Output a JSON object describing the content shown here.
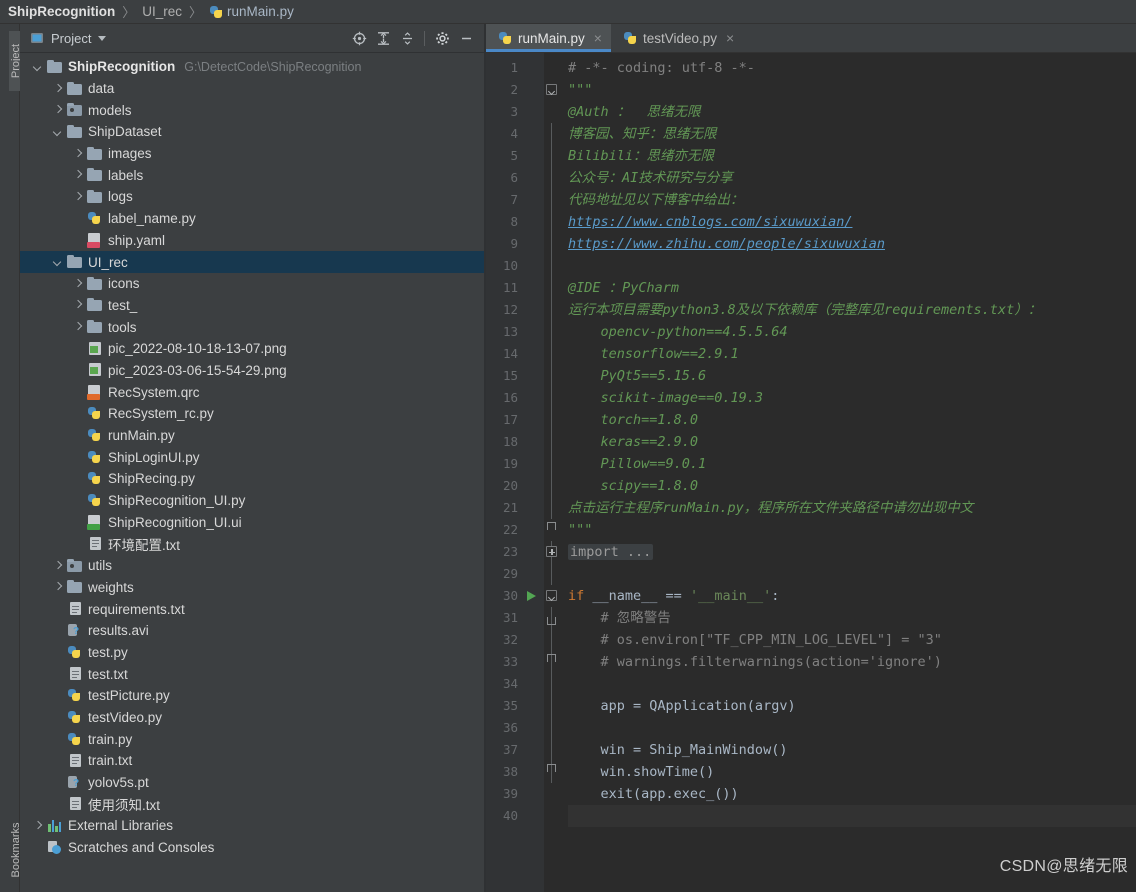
{
  "breadcrumb": {
    "items": [
      {
        "label": "ShipRecognition",
        "icon": "none",
        "style": "root"
      },
      {
        "label": "UI_rec",
        "icon": "none",
        "style": "mid"
      },
      {
        "label": "runMain.py",
        "icon": "python-icon",
        "style": "leaf"
      }
    ],
    "separator": "〉"
  },
  "left_strip": {
    "project_label": "Project",
    "bookmarks_label": "Bookmarks"
  },
  "project_panel": {
    "title": "Project",
    "toolbar_icons": [
      {
        "name": "select-opened-file-icon",
        "glyph": "target"
      },
      {
        "name": "expand-all-icon",
        "glyph": "expand"
      },
      {
        "name": "collapse-all-icon",
        "glyph": "collapse"
      },
      {
        "name": "settings-gear-icon",
        "glyph": "gear"
      },
      {
        "name": "hide-panel-icon",
        "glyph": "minus"
      }
    ],
    "tree": [
      {
        "label": "ShipRecognition",
        "hint": "G:\\DetectCode\\ShipRecognition",
        "indent": 0,
        "arrow": "down",
        "icon": "folder",
        "bold": true,
        "selected": false
      },
      {
        "label": "data",
        "hint": "",
        "indent": 1,
        "arrow": "right",
        "icon": "folder",
        "bold": false,
        "selected": false
      },
      {
        "label": "models",
        "hint": "",
        "indent": 1,
        "arrow": "right",
        "icon": "folder-src",
        "bold": false,
        "selected": false
      },
      {
        "label": "ShipDataset",
        "hint": "",
        "indent": 1,
        "arrow": "down",
        "icon": "folder",
        "bold": false,
        "selected": false
      },
      {
        "label": "images",
        "hint": "",
        "indent": 2,
        "arrow": "right",
        "icon": "folder",
        "bold": false,
        "selected": false
      },
      {
        "label": "labels",
        "hint": "",
        "indent": 2,
        "arrow": "right",
        "icon": "folder",
        "bold": false,
        "selected": false
      },
      {
        "label": "logs",
        "hint": "",
        "indent": 2,
        "arrow": "right",
        "icon": "folder",
        "bold": false,
        "selected": false
      },
      {
        "label": "label_name.py",
        "hint": "",
        "indent": 2,
        "arrow": "none",
        "icon": "python",
        "bold": false,
        "selected": false
      },
      {
        "label": "ship.yaml",
        "hint": "",
        "indent": 2,
        "arrow": "none",
        "icon": "yaml",
        "bold": false,
        "selected": false
      },
      {
        "label": "UI_rec",
        "hint": "",
        "indent": 1,
        "arrow": "down",
        "icon": "folder",
        "bold": false,
        "selected": true
      },
      {
        "label": "icons",
        "hint": "",
        "indent": 2,
        "arrow": "right",
        "icon": "folder",
        "bold": false,
        "selected": false
      },
      {
        "label": "test_",
        "hint": "",
        "indent": 2,
        "arrow": "right",
        "icon": "folder",
        "bold": false,
        "selected": false
      },
      {
        "label": "tools",
        "hint": "",
        "indent": 2,
        "arrow": "right",
        "icon": "folder",
        "bold": false,
        "selected": false
      },
      {
        "label": "pic_2022-08-10-18-13-07.png",
        "hint": "",
        "indent": 2,
        "arrow": "none",
        "icon": "image",
        "bold": false,
        "selected": false
      },
      {
        "label": "pic_2023-03-06-15-54-29.png",
        "hint": "",
        "indent": 2,
        "arrow": "none",
        "icon": "image",
        "bold": false,
        "selected": false
      },
      {
        "label": "RecSystem.qrc",
        "hint": "",
        "indent": 2,
        "arrow": "none",
        "icon": "qrc",
        "bold": false,
        "selected": false
      },
      {
        "label": "RecSystem_rc.py",
        "hint": "",
        "indent": 2,
        "arrow": "none",
        "icon": "python",
        "bold": false,
        "selected": false
      },
      {
        "label": "runMain.py",
        "hint": "",
        "indent": 2,
        "arrow": "none",
        "icon": "python",
        "bold": false,
        "selected": false
      },
      {
        "label": "ShipLoginUI.py",
        "hint": "",
        "indent": 2,
        "arrow": "none",
        "icon": "python",
        "bold": false,
        "selected": false
      },
      {
        "label": "ShipRecing.py",
        "hint": "",
        "indent": 2,
        "arrow": "none",
        "icon": "python",
        "bold": false,
        "selected": false
      },
      {
        "label": "ShipRecognition_UI.py",
        "hint": "",
        "indent": 2,
        "arrow": "none",
        "icon": "python",
        "bold": false,
        "selected": false
      },
      {
        "label": "ShipRecognition_UI.ui",
        "hint": "",
        "indent": 2,
        "arrow": "none",
        "icon": "ui",
        "bold": false,
        "selected": false
      },
      {
        "label": "环境配置.txt",
        "hint": "",
        "indent": 2,
        "arrow": "none",
        "icon": "txt",
        "bold": false,
        "selected": false
      },
      {
        "label": "utils",
        "hint": "",
        "indent": 1,
        "arrow": "right",
        "icon": "folder-src",
        "bold": false,
        "selected": false
      },
      {
        "label": "weights",
        "hint": "",
        "indent": 1,
        "arrow": "right",
        "icon": "folder",
        "bold": false,
        "selected": false
      },
      {
        "label": "requirements.txt",
        "hint": "",
        "indent": 1,
        "arrow": "none",
        "icon": "txt",
        "bold": false,
        "selected": false
      },
      {
        "label": "results.avi",
        "hint": "",
        "indent": 1,
        "arrow": "none",
        "icon": "unknown",
        "bold": false,
        "selected": false
      },
      {
        "label": "test.py",
        "hint": "",
        "indent": 1,
        "arrow": "none",
        "icon": "python",
        "bold": false,
        "selected": false
      },
      {
        "label": "test.txt",
        "hint": "",
        "indent": 1,
        "arrow": "none",
        "icon": "txt",
        "bold": false,
        "selected": false
      },
      {
        "label": "testPicture.py",
        "hint": "",
        "indent": 1,
        "arrow": "none",
        "icon": "python",
        "bold": false,
        "selected": false
      },
      {
        "label": "testVideo.py",
        "hint": "",
        "indent": 1,
        "arrow": "none",
        "icon": "python",
        "bold": false,
        "selected": false
      },
      {
        "label": "train.py",
        "hint": "",
        "indent": 1,
        "arrow": "none",
        "icon": "python",
        "bold": false,
        "selected": false
      },
      {
        "label": "train.txt",
        "hint": "",
        "indent": 1,
        "arrow": "none",
        "icon": "txt",
        "bold": false,
        "selected": false
      },
      {
        "label": "yolov5s.pt",
        "hint": "",
        "indent": 1,
        "arrow": "none",
        "icon": "unknown",
        "bold": false,
        "selected": false
      },
      {
        "label": "使用须知.txt",
        "hint": "",
        "indent": 1,
        "arrow": "none",
        "icon": "txt",
        "bold": false,
        "selected": false
      },
      {
        "label": "External Libraries",
        "hint": "",
        "indent": 0,
        "arrow": "right",
        "icon": "lib",
        "bold": false,
        "selected": false
      },
      {
        "label": "Scratches and Consoles",
        "hint": "",
        "indent": 0,
        "arrow": "none",
        "icon": "scratch",
        "bold": false,
        "selected": false
      }
    ]
  },
  "editor": {
    "tabs": [
      {
        "label": "runMain.py",
        "icon": "python-icon",
        "active": true,
        "close": "×"
      },
      {
        "label": "testVideo.py",
        "icon": "python-icon",
        "active": false,
        "close": "×"
      }
    ],
    "line_numbers": [
      "1",
      "2",
      "3",
      "4",
      "5",
      "6",
      "7",
      "8",
      "9",
      "10",
      "11",
      "12",
      "13",
      "14",
      "15",
      "16",
      "17",
      "18",
      "19",
      "20",
      "21",
      "22",
      "23",
      "29",
      "30",
      "31",
      "32",
      "33",
      "34",
      "35",
      "36",
      "37",
      "38",
      "39",
      "40"
    ],
    "run_marker_line_index": 24,
    "lines": [
      {
        "n": "1",
        "segments": [
          {
            "t": "# -*- coding: utf-8 -*-",
            "c": "c-comment"
          }
        ]
      },
      {
        "n": "2",
        "segments": [
          {
            "t": "\"\"\"",
            "c": "c-doc-q"
          }
        ]
      },
      {
        "n": "3",
        "segments": [
          {
            "t": "@Auth ：  思绪无限",
            "c": "c-doc"
          }
        ]
      },
      {
        "n": "4",
        "segments": [
          {
            "t": "博客园、知乎：思绪无限",
            "c": "c-doc"
          }
        ]
      },
      {
        "n": "5",
        "segments": [
          {
            "t": "Bilibili：思绪亦无限",
            "c": "c-doc"
          }
        ]
      },
      {
        "n": "6",
        "segments": [
          {
            "t": "公众号：AI技术研究与分享",
            "c": "c-doc"
          }
        ]
      },
      {
        "n": "7",
        "segments": [
          {
            "t": "代码地址见以下博客中给出：",
            "c": "c-doc"
          }
        ]
      },
      {
        "n": "8",
        "segments": [
          {
            "t": "https://www.cnblogs.com/sixuwuxian/",
            "c": "c-link"
          }
        ]
      },
      {
        "n": "9",
        "segments": [
          {
            "t": "https://www.zhihu.com/people/sixuwuxian",
            "c": "c-link"
          }
        ]
      },
      {
        "n": "10",
        "segments": []
      },
      {
        "n": "11",
        "segments": [
          {
            "t": "@IDE ：PyCharm",
            "c": "c-doc"
          }
        ]
      },
      {
        "n": "12",
        "segments": [
          {
            "t": "运行本项目需要python3.8及以下依赖库（完整库见requirements.txt）：",
            "c": "c-doc"
          }
        ]
      },
      {
        "n": "13",
        "segments": [
          {
            "t": "    opencv-python==4.5.5.64",
            "c": "c-doc"
          }
        ]
      },
      {
        "n": "14",
        "segments": [
          {
            "t": "    tensorflow==2.9.1",
            "c": "c-doc"
          }
        ]
      },
      {
        "n": "15",
        "segments": [
          {
            "t": "    PyQt5==5.15.6",
            "c": "c-doc"
          }
        ]
      },
      {
        "n": "16",
        "segments": [
          {
            "t": "    scikit-image==0.19.3",
            "c": "c-doc"
          }
        ]
      },
      {
        "n": "17",
        "segments": [
          {
            "t": "    torch==1.8.0",
            "c": "c-doc"
          }
        ]
      },
      {
        "n": "18",
        "segments": [
          {
            "t": "    keras==2.9.0",
            "c": "c-doc"
          }
        ]
      },
      {
        "n": "19",
        "segments": [
          {
            "t": "    Pillow==9.0.1",
            "c": "c-doc"
          }
        ]
      },
      {
        "n": "20",
        "segments": [
          {
            "t": "    scipy==1.8.0",
            "c": "c-doc"
          }
        ]
      },
      {
        "n": "21",
        "segments": [
          {
            "t": "点击运行主程序runMain.py，程序所在文件夹路径中请勿出现中文",
            "c": "c-doc"
          }
        ]
      },
      {
        "n": "22",
        "segments": [
          {
            "t": "\"\"\"",
            "c": "c-doc-q"
          }
        ]
      },
      {
        "n": "23",
        "segments": [
          {
            "t": "import ...",
            "c": "fold-chip"
          }
        ]
      },
      {
        "n": "29",
        "segments": []
      },
      {
        "n": "30",
        "segments": [
          {
            "t": "if",
            "c": "c-kw"
          },
          {
            "t": " __name__ ",
            "c": "c-plain"
          },
          {
            "t": "==",
            "c": "c-plain"
          },
          {
            "t": " ",
            "c": "c-plain"
          },
          {
            "t": "'__main__'",
            "c": "c-str"
          },
          {
            "t": ":",
            "c": "c-plain"
          }
        ]
      },
      {
        "n": "31",
        "segments": [
          {
            "t": "    # 忽略警告",
            "c": "c-comment"
          }
        ]
      },
      {
        "n": "32",
        "segments": [
          {
            "t": "    # os.environ[\"TF_CPP_MIN_LOG_LEVEL\"] = \"3\"",
            "c": "c-comment"
          }
        ]
      },
      {
        "n": "33",
        "segments": [
          {
            "t": "    # warnings.filterwarnings(action='ignore')",
            "c": "c-comment"
          }
        ]
      },
      {
        "n": "34",
        "segments": []
      },
      {
        "n": "35",
        "segments": [
          {
            "t": "    app = QApplication(argv)",
            "c": "c-plain"
          }
        ]
      },
      {
        "n": "36",
        "segments": []
      },
      {
        "n": "37",
        "segments": [
          {
            "t": "    win = Ship_MainWindow()",
            "c": "c-plain"
          }
        ]
      },
      {
        "n": "38",
        "segments": [
          {
            "t": "    win.showTime()",
            "c": "c-plain"
          }
        ]
      },
      {
        "n": "39",
        "segments": [
          {
            "t": "    exit(app.exec_())",
            "c": "c-plain"
          }
        ]
      },
      {
        "n": "40",
        "segments": []
      }
    ]
  },
  "watermark": {
    "text": "CSDN@思绪无限"
  },
  "colors": {
    "panel_bg": "#3c3f41",
    "editor_bg": "#2b2b2b",
    "gutter_bg": "#313335",
    "selection_bg": "#17384f",
    "tab_active_bg": "#4e5254",
    "tab_underline": "#4a88c7",
    "doc_green": "#629755",
    "link_blue": "#5a9ac9",
    "keyword_orange": "#cc7832",
    "string_green": "#6a8759",
    "comment_gray": "#808080",
    "text_main": "#a9b7c6"
  }
}
